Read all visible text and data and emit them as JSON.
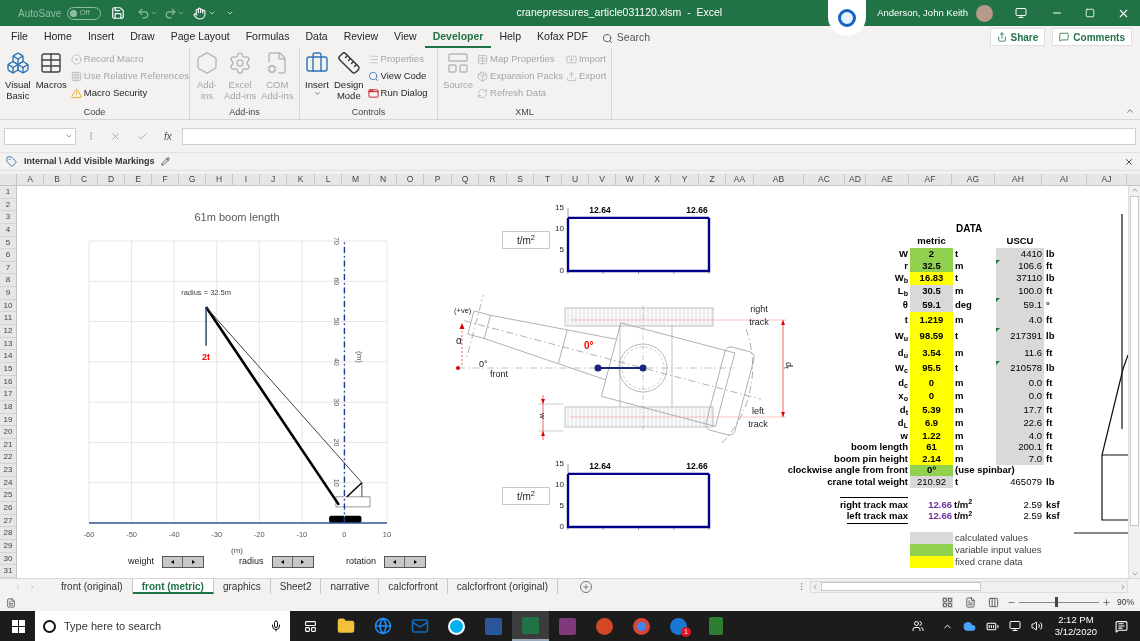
{
  "title_bar": {
    "autosave_label": "AutoSave",
    "autosave": {
      "on": false,
      "label": "Off"
    },
    "title": "cranepressures_article031120.xlsm  -  Excel",
    "user": "Anderson, John Keith"
  },
  "menu_tabs": [
    {
      "label": "File",
      "selected": false
    },
    {
      "label": "Home",
      "selected": false
    },
    {
      "label": "Insert",
      "selected": false
    },
    {
      "label": "Draw",
      "selected": false
    },
    {
      "label": "Page Layout",
      "selected": false
    },
    {
      "label": "Formulas",
      "selected": false
    },
    {
      "label": "Data",
      "selected": false
    },
    {
      "label": "Review",
      "selected": false
    },
    {
      "label": "View",
      "selected": false
    },
    {
      "label": "Developer",
      "selected": true
    },
    {
      "label": "Help",
      "selected": false
    },
    {
      "label": "Kofax PDF",
      "selected": false
    }
  ],
  "search": {
    "placeholder": "Search"
  },
  "share": "Share",
  "comments": "Comments",
  "ribbon_groups": [
    {
      "label": "Code",
      "columns": [
        {
          "kind": "large",
          "lines": [
            "Visual",
            "Basic"
          ],
          "disabled": false,
          "dropdown": false
        },
        {
          "kind": "large",
          "lines": [
            "Macros"
          ],
          "disabled": false,
          "dropdown": false
        },
        {
          "kind": "stack",
          "items": [
            {
              "label": "Record Macro",
              "disabled": true
            },
            {
              "label": "Use Relative References",
              "disabled": true
            },
            {
              "label": "Macro Security",
              "disabled": false
            }
          ]
        }
      ]
    },
    {
      "label": "Add-ins",
      "columns": [
        {
          "kind": "large",
          "lines": [
            "Add-",
            "ins"
          ],
          "disabled": true,
          "dropdown": false
        },
        {
          "kind": "large",
          "lines": [
            "Excel",
            "Add-ins"
          ],
          "disabled": true,
          "dropdown": false
        },
        {
          "kind": "large",
          "lines": [
            "COM",
            "Add-ins"
          ],
          "disabled": true,
          "dropdown": false
        }
      ]
    },
    {
      "label": "Controls",
      "columns": [
        {
          "kind": "large",
          "lines": [
            "Insert"
          ],
          "disabled": false,
          "dropdown": true
        },
        {
          "kind": "large",
          "lines": [
            "Design",
            "Mode"
          ],
          "disabled": false,
          "dropdown": false
        },
        {
          "kind": "stack",
          "items": [
            {
              "label": "Properties",
              "disabled": true
            },
            {
              "label": "View Code",
              "disabled": false
            },
            {
              "label": "Run Dialog",
              "disabled": false
            }
          ]
        }
      ]
    },
    {
      "label": "XML",
      "columns": [
        {
          "kind": "large",
          "lines": [
            "Source"
          ],
          "disabled": true,
          "dropdown": false
        },
        {
          "kind": "stack",
          "items": [
            {
              "label": "Map Properties",
              "disabled": true
            },
            {
              "label": "Expansion Packs",
              "disabled": true
            },
            {
              "label": "Refresh Data",
              "disabled": true
            }
          ]
        },
        {
          "kind": "stack",
          "items": [
            {
              "label": "Import",
              "disabled": true
            },
            {
              "label": "Export",
              "disabled": true
            }
          ]
        }
      ]
    }
  ],
  "formula_bar": {
    "function_label": "fx"
  },
  "info_bar": {
    "text": "Internal \\ Add Visible Markings"
  },
  "column_headers": [
    "A",
    "B",
    "C",
    "D",
    "E",
    "F",
    "G",
    "H",
    "I",
    "J",
    "K",
    "L",
    "M",
    "N",
    "O",
    "P",
    "Q",
    "R",
    "S",
    "T",
    "U",
    "V",
    "W",
    "X",
    "Y",
    "Z",
    "AA",
    "AB",
    "AC",
    "AD",
    "AE",
    "AF",
    "AG",
    "AH",
    "AI",
    "AJ"
  ],
  "row_headers": [
    "1",
    "2",
    "3",
    "4",
    "5",
    "6",
    "7",
    "8",
    "9",
    "10",
    "11",
    "12",
    "13",
    "14",
    "15",
    "16",
    "17",
    "18",
    "19",
    "20",
    "21",
    "22",
    "23",
    "24",
    "25",
    "26",
    "27",
    "28",
    "29",
    "30",
    "31"
  ],
  "boom_chart": {
    "chart_data": {
      "type": "line",
      "title": "61m boom length",
      "xlabel": "(m)",
      "ylabel": "(m)",
      "xlim": [
        -60,
        10
      ],
      "ylim": [
        0,
        70
      ],
      "xticks": [
        -60,
        -50,
        -40,
        -30,
        -20,
        -10,
        0,
        10
      ],
      "yticks": [
        10,
        20,
        30,
        40,
        50,
        60,
        70
      ],
      "grid": true,
      "series": [
        {
          "color": "#000000",
          "x": [
            -32.5,
            -1.3
          ],
          "values": [
            53.6,
            4.5
          ]
        },
        {
          "color": "#404040",
          "x": [
            -32.5,
            4.1,
            4.1
          ],
          "values": [
            53.6,
            10,
            6.5
          ]
        },
        {
          "color": "#000000",
          "x": [
            0.6,
            4.1
          ],
          "values": [
            6.5,
            10
          ]
        },
        {
          "color": "#1f3864",
          "x": [
            -32.5,
            -32.5
          ],
          "values": [
            53.6,
            44
          ]
        },
        {
          "color": "#1f3a93",
          "x": [
            0,
            0
          ],
          "values": [
            0,
            70
          ],
          "line_style": "dashdot"
        }
      ],
      "annotations": [
        "radius = 32.5m",
        "2t"
      ]
    }
  },
  "spinners": [
    {
      "label": "weight"
    },
    {
      "label": "radius"
    },
    {
      "label": "rotation"
    }
  ],
  "pressure_charts": [
    {
      "axis_title": "t/m$^{2}$",
      "chart_data": {
        "type": "line",
        "categories": [
          null,
          null
        ],
        "ylim": [
          0,
          15
        ],
        "yticks": [
          0,
          5,
          10,
          15
        ],
        "data_labels": true,
        "series": [
          {
            "color": "#00008b",
            "values": [
              12.64,
              12.66
            ]
          }
        ]
      }
    },
    {
      "axis_title": "t/m$^{2}$",
      "chart_data": {
        "type": "line",
        "categories": [
          null,
          null
        ],
        "ylim": [
          0,
          15
        ],
        "yticks": [
          0,
          5,
          10,
          15
        ],
        "data_labels": true,
        "series": [
          {
            "color": "#00008b",
            "values": [
              12.64,
              12.66
            ]
          }
        ]
      }
    }
  ],
  "plan_view": {
    "direction_note": "(+ve)",
    "angle_symbol": "α",
    "boom_angle": "0°",
    "front_angle": "0°",
    "front_label": "front",
    "right_track": "right track",
    "left_track": "left track",
    "track_width": "w",
    "track_spacing": "d$_{t}$"
  },
  "data_table": {
    "title": "DATA",
    "metric_header": "metric",
    "uscu_header": "USCU",
    "rows": [
      {
        "label": "W",
        "value": "2",
        "kind": "input",
        "unit": "t",
        "uscu": "4410",
        "uscu_unit": "lb",
        "uscu_shaded": true,
        "note": false
      },
      {
        "label": "r",
        "value": "32.5",
        "kind": "input",
        "unit": "m",
        "uscu": "106.6",
        "uscu_unit": "ft",
        "uscu_shaded": true,
        "note": true
      },
      {
        "label": "W$_{b}$",
        "value": "16.83",
        "kind": "fixed",
        "unit": "t",
        "uscu": "37110",
        "uscu_unit": "lb",
        "uscu_shaded": true,
        "note": false
      },
      {
        "label": "L$_{b}$",
        "value": "30.5",
        "kind": "calculated",
        "unit": "m",
        "uscu": "100.0",
        "uscu_unit": "ft",
        "uscu_shaded": true,
        "note": false
      },
      {
        "label": "θ",
        "value": "59.1",
        "kind": "calculated",
        "unit": "deg",
        "uscu": "59.1",
        "uscu_unit": "°",
        "uscu_shaded": true,
        "note": true
      },
      {
        "label": "t",
        "value": "1.219",
        "kind": "fixed",
        "unit": "m",
        "uscu": "4.0",
        "uscu_unit": "ft",
        "uscu_shaded": true,
        "note": false
      },
      {
        "label": "W$_{u}$",
        "value": "98.59",
        "kind": "fixed",
        "unit": "t",
        "uscu": "217391",
        "uscu_unit": "lb",
        "uscu_shaded": true,
        "note": true
      },
      {
        "label": "d$_{u}$",
        "value": "3.54",
        "kind": "fixed",
        "unit": "m",
        "uscu": "11.6",
        "uscu_unit": "ft",
        "uscu_shaded": true,
        "note": false
      },
      {
        "label": "W$_{c}$",
        "value": "95.5",
        "kind": "fixed",
        "unit": "t",
        "uscu": "210578",
        "uscu_unit": "lb",
        "uscu_shaded": true,
        "note": true
      },
      {
        "label": "d$_{c}$",
        "value": "0",
        "kind": "fixed",
        "unit": "m",
        "uscu": "0.0",
        "uscu_unit": "ft",
        "uscu_shaded": true,
        "note": false
      },
      {
        "label": "x$_{o}$",
        "value": "0",
        "kind": "fixed",
        "unit": "m",
        "uscu": "0.0",
        "uscu_unit": "ft",
        "uscu_shaded": true,
        "note": false
      },
      {
        "label": "d$_{t}$",
        "value": "5.39",
        "kind": "fixed",
        "unit": "m",
        "uscu": "17.7",
        "uscu_unit": "ft",
        "uscu_shaded": true,
        "note": false
      },
      {
        "label": "d$_{L}$",
        "value": "6.9",
        "kind": "fixed",
        "unit": "m",
        "uscu": "22.6",
        "uscu_unit": "ft",
        "uscu_shaded": true,
        "note": false
      },
      {
        "label": "w",
        "value": "1.22",
        "kind": "fixed",
        "unit": "m",
        "uscu": "4.0",
        "uscu_unit": "ft",
        "uscu_shaded": true,
        "note": false
      },
      {
        "label": "boom length",
        "value": "61",
        "kind": "fixed",
        "unit": "m",
        "uscu": "200.1",
        "uscu_unit": "ft",
        "uscu_shaded": true,
        "note": false
      },
      {
        "label": "boom pin height",
        "value": "2.14",
        "kind": "fixed",
        "unit": "m",
        "uscu": "7.0",
        "uscu_unit": "ft",
        "uscu_shaded": true,
        "note": false
      },
      {
        "label": "clockwise angle from front",
        "value": "0º",
        "kind": "input",
        "unit": "(use spinbar)"
      },
      {
        "label": "crane total weight",
        "value": "210.92",
        "kind": "calculated",
        "unit": "t",
        "uscu": "465079",
        "uscu_unit": "lb",
        "uscu_shaded": false,
        "note": false
      }
    ],
    "track_max": [
      {
        "label": "right track max",
        "value": "12.66",
        "unit": "t/m$^{2}$",
        "uscu": "2.59",
        "uscu_unit": "ksf"
      },
      {
        "label": "left track max",
        "value": "12.66",
        "unit": "t/m$^{2}$",
        "uscu": "2.59",
        "uscu_unit": "ksf"
      }
    ],
    "legend": [
      {
        "kind": "calculated",
        "label": "calculated values"
      },
      {
        "kind": "input",
        "label": "variable input values"
      },
      {
        "kind": "fixed",
        "label": "fixed crane data"
      }
    ]
  },
  "sheet_tabs": [
    {
      "label": "front (original)",
      "selected": false
    },
    {
      "label": "front (metric)",
      "selected": true
    },
    {
      "label": "graphics",
      "selected": false
    },
    {
      "label": "Sheet2",
      "selected": false
    },
    {
      "label": "narrative",
      "selected": false
    },
    {
      "label": "calcforfront",
      "selected": false
    },
    {
      "label": "calcforfront (original)",
      "selected": false
    }
  ],
  "status_bar": {
    "zoom": {
      "level": 0.45,
      "label": "90%"
    }
  },
  "taskbar": {
    "search": {
      "placeholder": "Type here to search"
    },
    "apps": [
      {
        "selected": false
      },
      {
        "selected": false
      },
      {
        "selected": false
      },
      {
        "selected": false
      },
      {
        "selected": false
      },
      {
        "selected": true
      },
      {
        "selected": false
      },
      {
        "selected": false
      },
      {
        "selected": false
      },
      {
        "selected": false,
        "badge": "1"
      },
      {
        "selected": false
      }
    ],
    "time": "2:12 PM",
    "date": "3/12/2020"
  }
}
